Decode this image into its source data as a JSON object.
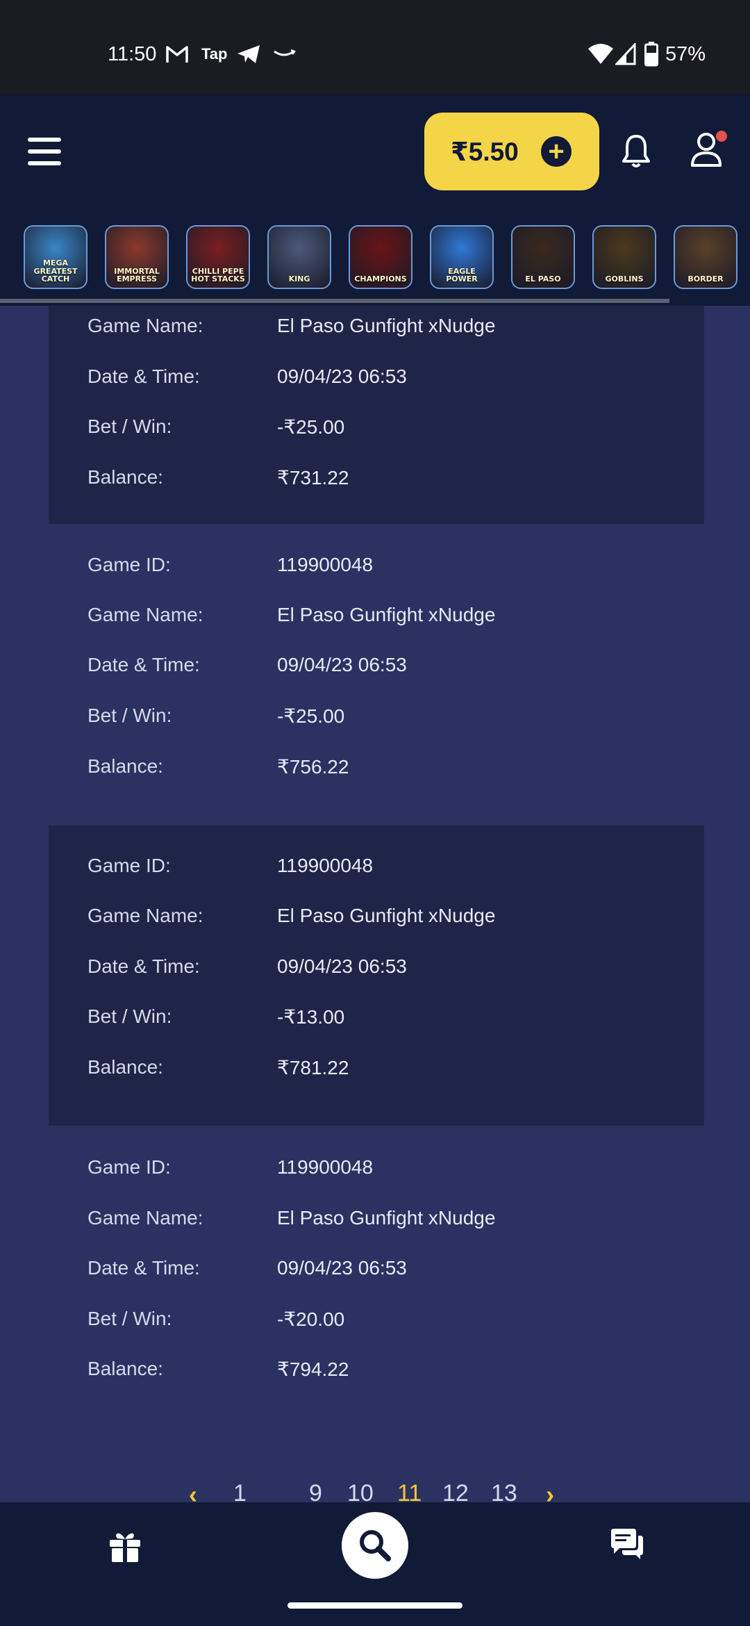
{
  "status_bar": {
    "time": "11:50",
    "tap_label": "Tap",
    "battery": "57%"
  },
  "header": {
    "balance": "₹5.50",
    "plus_symbol": "+"
  },
  "games": [
    {
      "title": "MEGA GREATEST CATCH",
      "color": "#3a86c8"
    },
    {
      "title": "IMMORTAL EMPRESS",
      "color": "#8b3a2a"
    },
    {
      "title": "CHILLI PEPE HOT STACKS",
      "color": "#7a1f1f"
    },
    {
      "title": "KING",
      "color": "#4b5a7a"
    },
    {
      "title": "CHAMPIONS",
      "color": "#6a1414"
    },
    {
      "title": "EAGLE POWER",
      "color": "#2f79d6"
    },
    {
      "title": "EL PASO",
      "color": "#3a2a1f"
    },
    {
      "title": "GOBLINS",
      "color": "#4a3a1a"
    },
    {
      "title": "BORDER",
      "color": "#5a4028"
    }
  ],
  "labels": {
    "game_id": "Game ID:",
    "game_name": "Game Name:",
    "date_time": "Date & Time:",
    "bet_win": "Bet / Win:",
    "balance": "Balance:"
  },
  "records": [
    {
      "game_id": "",
      "game_name": "El Paso Gunfight xNudge",
      "date_time": "09/04/23 06:53",
      "bet_win": "-₹25.00",
      "balance": "₹731.22"
    },
    {
      "game_id": "119900048",
      "game_name": "El Paso Gunfight xNudge",
      "date_time": "09/04/23 06:53",
      "bet_win": "-₹25.00",
      "balance": "₹756.22"
    },
    {
      "game_id": "119900048",
      "game_name": "El Paso Gunfight xNudge",
      "date_time": "09/04/23 06:53",
      "bet_win": "-₹13.00",
      "balance": "₹781.22"
    },
    {
      "game_id": "119900048",
      "game_name": "El Paso Gunfight xNudge",
      "date_time": "09/04/23 06:53",
      "bet_win": "-₹20.00",
      "balance": "₹794.22"
    }
  ],
  "pagination": {
    "prev": "‹",
    "next": "›",
    "pages": [
      "1",
      "9",
      "10",
      "11",
      "12",
      "13"
    ],
    "active": "11"
  },
  "bottom_nav": {
    "icons": [
      "gift-icon",
      "search-icon",
      "chat-icon"
    ]
  }
}
